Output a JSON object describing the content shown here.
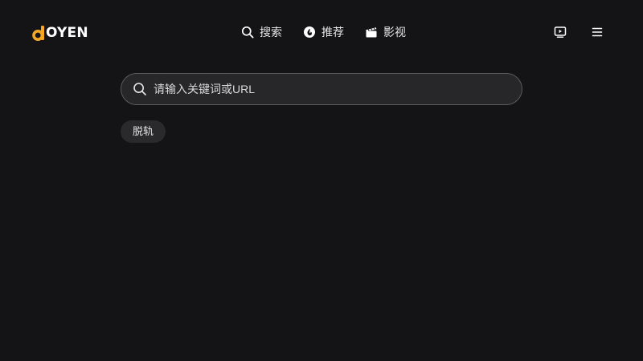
{
  "brand": {
    "logo_text": "OYEN",
    "accent_color": "#f5a623"
  },
  "nav": {
    "items": [
      {
        "label": "搜索",
        "icon": "search-icon"
      },
      {
        "label": "推荐",
        "icon": "recommend-icon"
      },
      {
        "label": "影视",
        "icon": "clapperboard-icon"
      }
    ]
  },
  "header_actions": {
    "icons": [
      "tv-play-icon",
      "menu-icon"
    ]
  },
  "search": {
    "placeholder": "请输入关键词或URL",
    "value": ""
  },
  "history": {
    "tags": [
      "脱轨"
    ]
  }
}
